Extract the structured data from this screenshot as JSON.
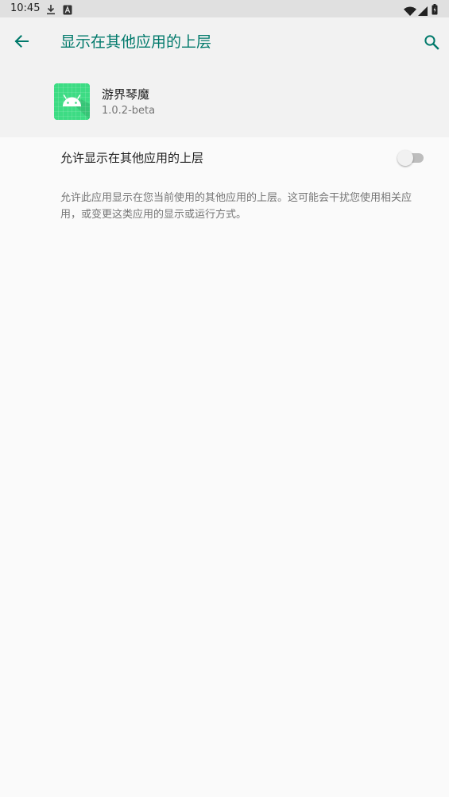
{
  "status_bar": {
    "time": "10:45",
    "icons": [
      "download-icon",
      "a-badge-icon",
      "wifi-icon",
      "signal-icon",
      "battery-icon"
    ]
  },
  "toolbar": {
    "title": "显示在其他应用的上层",
    "back_icon": "arrow-back-icon",
    "search_icon": "search-icon"
  },
  "app": {
    "name": "游界琴魔",
    "version": "1.0.2-beta",
    "icon": "android-app-icon"
  },
  "setting": {
    "label": "允许显示在其他应用的上层",
    "enabled": false,
    "description": "允许此应用显示在您当前使用的其他应用的上层。这可能会干扰您使用相关应用，或变更这类应用的显示或运行方式。"
  },
  "colors": {
    "accent": "#00796b",
    "app_icon_bg": "#3ddc84",
    "toggle_track_off": "#bdbdbd",
    "toggle_thumb_off": "#f1f1f1"
  }
}
